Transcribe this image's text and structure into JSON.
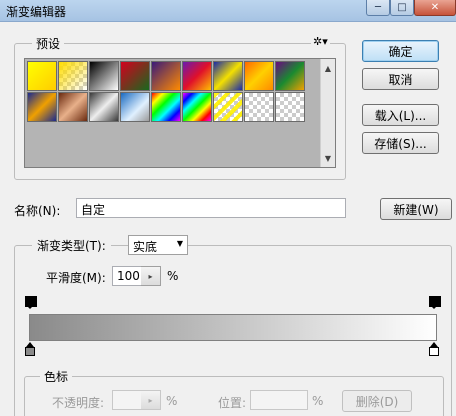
{
  "window": {
    "title": "渐变编辑器",
    "min_glyph": "─",
    "max_glyph": "□",
    "close_glyph": "✕"
  },
  "presets": {
    "label": "预设",
    "settings_glyph": "✲▾",
    "scroll_up": "▲",
    "scroll_down": "▼"
  },
  "buttons": {
    "ok": "确定",
    "cancel": "取消",
    "load": "载入(L)...",
    "save": "存储(S)...",
    "new": "新建(W)"
  },
  "name": {
    "label": "名称(N):",
    "value": "自定"
  },
  "gradient": {
    "type_label": "渐变类型(T):",
    "type_value": "实底",
    "smoothness_label": "平滑度(M):",
    "smoothness_value": "100",
    "smoothness_unit": "%",
    "dropdown_glyph": "▼",
    "spin_glyph": "▸"
  },
  "color_stops": {
    "label": "色标",
    "opacity_label": "不透明度:",
    "opacity_unit": "%",
    "location_label": "位置:",
    "location_unit": "%",
    "delete_label": "删除(D)"
  },
  "colors": {
    "gradient_start": "#8a8a8a",
    "gradient_end": "#ffffff"
  }
}
